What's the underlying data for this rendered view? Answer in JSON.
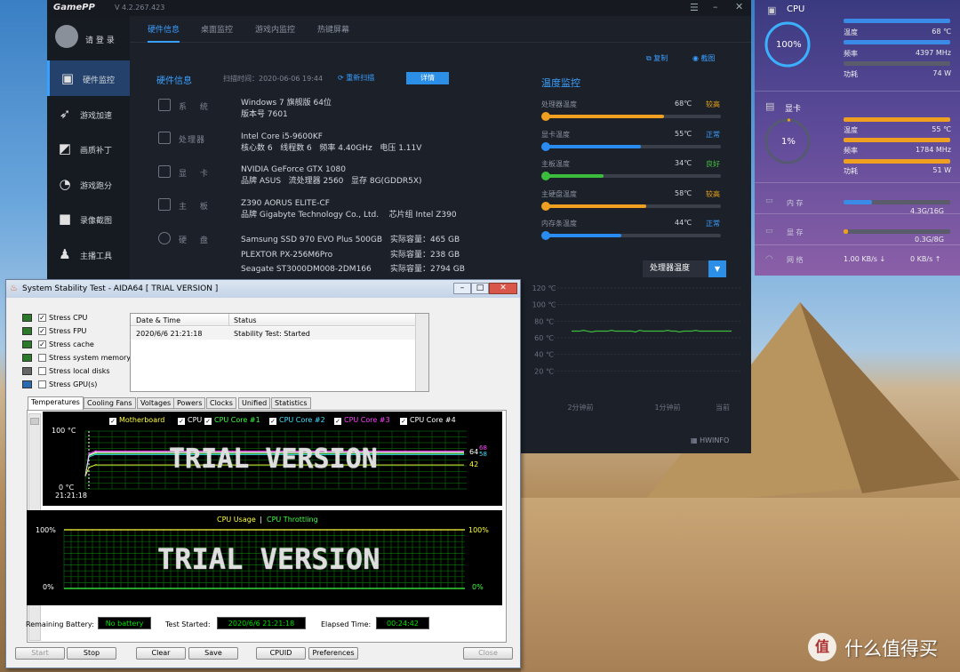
{
  "gamepp": {
    "logo": "GamePP",
    "version": "V 4.2.267.423",
    "login": "请 登 录",
    "sidebar": [
      {
        "label": "硬件监控",
        "icon": "monitor-icon"
      },
      {
        "label": "游戏加速",
        "icon": "rocket-icon"
      },
      {
        "label": "画质补丁",
        "icon": "picture-icon"
      },
      {
        "label": "游戏跑分",
        "icon": "gauge-icon"
      },
      {
        "label": "录像截图",
        "icon": "camera-icon"
      },
      {
        "label": "主播工具",
        "icon": "person-icon"
      }
    ],
    "tabs": [
      "硬件信息",
      "桌面监控",
      "游戏内监控",
      "热键屏幕"
    ],
    "hw_title": "硬件信息",
    "scan_time": "扫描时间：2020-06-06 19:44",
    "rescan": "重新扫描",
    "detail_btn": "详情",
    "copy": "复制",
    "screenshot": "截图",
    "hw": {
      "system_label": "系 统",
      "system_l1": "Windows 7 旗舰版 64位",
      "system_l2": "版本号 7601",
      "cpu_label": "处理器",
      "cpu_l1": "Intel Core i5-9600KF",
      "cpu_cores": "核心数 6",
      "cpu_threads": "线程数 6",
      "cpu_freq": "频率 4.40GHz",
      "cpu_volt": "电压 1.11V",
      "gpu_label": "显 卡",
      "gpu_l1": "NVIDIA GeForce GTX 1080",
      "gpu_brand": "品牌 ASUS",
      "gpu_sp": "流处理器 2560",
      "gpu_vram": "显存 8G(GDDR5X)",
      "mb_label": "主 板",
      "mb_l1": "Z390 AORUS ELITE-CF",
      "mb_brand": "品牌 Gigabyte Technology Co., Ltd.",
      "mb_chip": "芯片组 Intel Z390",
      "disk_label": "硬 盘",
      "disks": [
        {
          "name": "Samsung SSD 970 EVO Plus 500GB",
          "cap": "实际容量：465 GB"
        },
        {
          "name": "PLEXTOR PX-256M6Pro",
          "cap": "实际容量：238 GB"
        },
        {
          "name": "Seagate ST3000DM008-2DM166",
          "cap": "实际容量：2794 GB"
        }
      ]
    },
    "temp_title": "温度监控",
    "temps": [
      {
        "label": "处理器温度",
        "value": "68℃",
        "status": "较高",
        "status_color": "#e8a317",
        "color": "#f0a020",
        "pct": 0.68
      },
      {
        "label": "显卡温度",
        "value": "55℃",
        "status": "正常",
        "status_color": "#3aa0ff",
        "color": "#2a8cf0",
        "pct": 0.55
      },
      {
        "label": "主板温度",
        "value": "34℃",
        "status": "良好",
        "status_color": "#44c040",
        "color": "#3cbc3c",
        "pct": 0.34
      },
      {
        "label": "主硬盘温度",
        "value": "58℃",
        "status": "较高",
        "status_color": "#e8a317",
        "color": "#f0a020",
        "pct": 0.58
      },
      {
        "label": "内存条温度",
        "value": "44℃",
        "status": "正常",
        "status_color": "#3aa0ff",
        "color": "#2a8cf0",
        "pct": 0.44
      }
    ],
    "dropdown": "处理器温度",
    "chart_y": [
      "120 ℃",
      "100 ℃",
      "80 ℃",
      "60 ℃",
      "40 ℃",
      "20 ℃"
    ],
    "chart_x": [
      "2分钟前",
      "1分钟前",
      "当前"
    ],
    "hwinfo": "HWINFO"
  },
  "overlay": {
    "cpu": {
      "title": "CPU",
      "pct": "100%",
      "load": 1.0,
      "temp_label": "温度",
      "temp": "68 ℃",
      "freq_label": "频率",
      "freq": "4397 MHz",
      "power_label": "功耗",
      "power": "74 W"
    },
    "gpu": {
      "title": "显卡",
      "pct": "1%",
      "load": 0.01,
      "temp_label": "温度",
      "temp": "55 ℃",
      "freq_label": "频率",
      "freq": "1784 MHz",
      "power_label": "功耗",
      "power": "51 W"
    },
    "mem": {
      "label": "内 存",
      "value": "4.3G/16G",
      "fill": 0.27
    },
    "vram": {
      "label": "显 存",
      "value": "0.3G/8G",
      "fill": 0.04
    },
    "net": {
      "label": "网 络",
      "down": "1.00 KB/s ↓",
      "up": "0 KB/s ↑"
    }
  },
  "aida": {
    "title": "System Stability Test - AIDA64  [ TRIAL VERSION ]",
    "stress": [
      {
        "label": "Stress CPU",
        "checked": "✓"
      },
      {
        "label": "Stress FPU",
        "checked": "✓"
      },
      {
        "label": "Stress cache",
        "checked": "✓"
      },
      {
        "label": "Stress system memory",
        "checked": ""
      },
      {
        "label": "Stress local disks",
        "checked": ""
      },
      {
        "label": "Stress GPU(s)",
        "checked": ""
      }
    ],
    "log_headers": [
      "Date & Time",
      "Status"
    ],
    "log_row": [
      "2020/6/6 21:21:18",
      "Stability Test: Started"
    ],
    "tabs": [
      "Temperatures",
      "Cooling Fans",
      "Voltages",
      "Powers",
      "Clocks",
      "Unified",
      "Statistics"
    ],
    "legend": [
      {
        "label": "Motherboard",
        "color": "#ffff40"
      },
      {
        "label": "CPU",
        "color": "#ffffff"
      },
      {
        "label": "CPU Core #1",
        "color": "#40ff40"
      },
      {
        "label": "CPU Core #2",
        "color": "#40e0ff"
      },
      {
        "label": "CPU Core #3",
        "color": "#ff40ff"
      },
      {
        "label": "CPU Core #4",
        "color": "#ffffff"
      }
    ],
    "temp_top": "100 °C",
    "temp_bottom": "0 °C",
    "temp_time": "21:21:18",
    "temp_right": [
      "64",
      "68",
      "58",
      "42"
    ],
    "trial": "TRIAL VERSION",
    "usage_title": "CPU Usage",
    "usage_sep": "|",
    "throttle_title": "CPU Throttling",
    "usage_top": "100%",
    "usage_bottom": "0%",
    "battery_label": "Remaining Battery:",
    "battery": "No battery",
    "started_label": "Test Started:",
    "started": "2020/6/6 21:21:18",
    "elapsed_label": "Elapsed Time:",
    "elapsed": "00:24:42",
    "buttons": [
      "Start",
      "Stop",
      "Clear",
      "Save",
      "CPUID",
      "Preferences",
      "Close"
    ]
  },
  "watermark": {
    "text": "什么值得买",
    "logo_char": "值"
  }
}
